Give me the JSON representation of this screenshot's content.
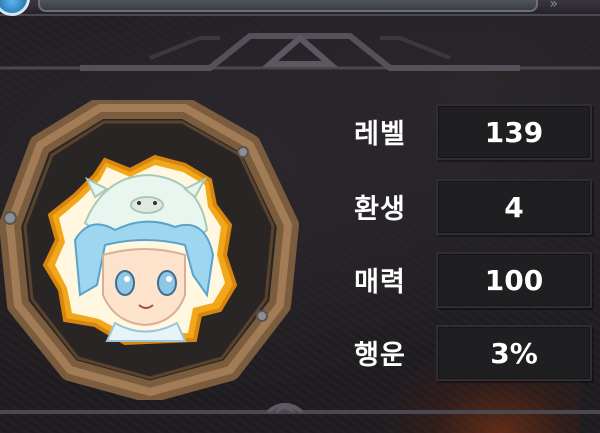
{
  "stats": [
    {
      "label": "레벨",
      "value": "139"
    },
    {
      "label": "환생",
      "value": "4"
    },
    {
      "label": "매력",
      "value": "100"
    },
    {
      "label": "행운",
      "value": "3%"
    }
  ],
  "colors": {
    "background": "#221f23",
    "frame_wood": "#8a6a48",
    "portrait_outline": "#f2a71b",
    "hair": "#9fd6ef",
    "stat_box": "#1f1e21",
    "text": "#ffffff"
  },
  "icons": {
    "top_emblem": "blue-emblem-icon",
    "ornament": "triangle-ornament-icon",
    "bottom_ornament": "chevron-ornament-icon"
  }
}
